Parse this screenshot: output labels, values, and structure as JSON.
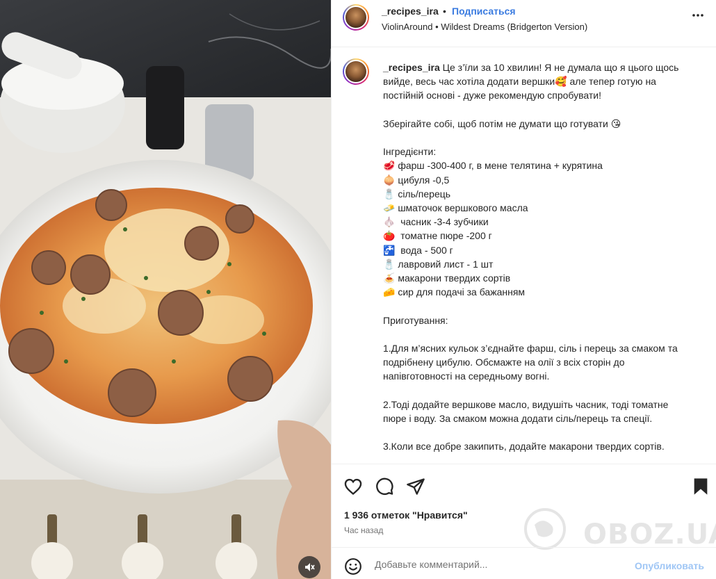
{
  "header": {
    "username": "_recipes_ira",
    "separator": "•",
    "follow_label": "Подписаться",
    "audio": "ViolinAround • Wildest Dreams (Bridgerton Version)",
    "more_icon": "more-horizontal-icon"
  },
  "caption": {
    "username": "_recipes_ira",
    "text": "Це з’їли за 10 хвилин! Я не думала що я цього щось вийде, весь час хотіла додати вершки🥰 але тепер готую на постійній основі - дуже рекомендую спробувати!\n\nЗберігайте собі, щоб потім не думати що готувати 😘\n\nІнгредієнти:\n🥩 фарш -300-400 г, в мене телятина + курятина\n🧅 цибуля -0,5\n🧂 сіль/перець\n🧈 шматочок вершкового масла\n🧄  часник -3-4 зубчики\n🍅  томатне пюре -200 г\n🚰  вода - 500 г\n🧂 лавровий лист - 1 шт\n🍝 макарони твердих сортів\n🧀 сир для подачі за бажанням\n\nПриготування:\n\n1.Для м’ясних кульок з’єднайте фарш, сіль і перець за смаком та подрібнену цибулю. Обсмажте на олії з всіх сторін до напівготовності на середньому вогні.\n\n2.Тоді додайте вершкове масло, видушіть часник, тоді томатне пюре і воду. За смаком можна додати сіль/перець та спеції.\n\n3.Коли все добре закипить, додайте макарони твердих сортів."
  },
  "actions": {
    "like_icon": "heart-icon",
    "comment_icon": "comment-icon",
    "share_icon": "share-icon",
    "save_icon": "bookmark-icon"
  },
  "likes_text": "1 936 отметок \"Нравится\"",
  "time_text": "Час назад",
  "comment": {
    "placeholder": "Добавьте комментарий...",
    "value": "",
    "publish_label": "Опубликовать"
  },
  "media": {
    "mute_icon": "muted-speaker-icon"
  },
  "watermark": {
    "text": "OBOZ.UA"
  }
}
